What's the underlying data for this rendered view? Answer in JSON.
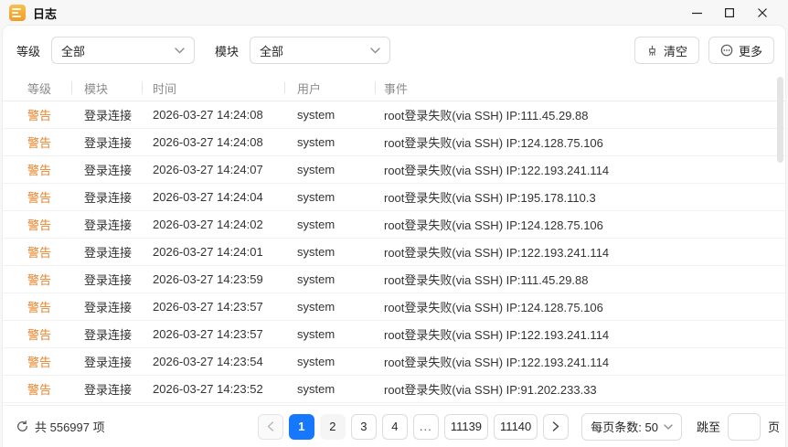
{
  "window": {
    "title": "日志"
  },
  "filters": {
    "level_label": "等级",
    "level_value": "全部",
    "module_label": "模块",
    "module_value": "全部"
  },
  "toolbar": {
    "clear_label": "清空",
    "more_label": "更多"
  },
  "table": {
    "headers": {
      "level": "等级",
      "module": "模块",
      "time": "时间",
      "user": "用户",
      "event": "事件"
    },
    "rows": [
      {
        "level": "警告",
        "module": "登录连接",
        "time": "2026-03-27 14:24:08",
        "user": "system",
        "event": "root登录失败(via SSH) IP:111.45.29.88"
      },
      {
        "level": "警告",
        "module": "登录连接",
        "time": "2026-03-27 14:24:08",
        "user": "system",
        "event": "root登录失败(via SSH) IP:124.128.75.106"
      },
      {
        "level": "警告",
        "module": "登录连接",
        "time": "2026-03-27 14:24:07",
        "user": "system",
        "event": "root登录失败(via SSH) IP:122.193.241.114"
      },
      {
        "level": "警告",
        "module": "登录连接",
        "time": "2026-03-27 14:24:04",
        "user": "system",
        "event": "root登录失败(via SSH) IP:195.178.110.3"
      },
      {
        "level": "警告",
        "module": "登录连接",
        "time": "2026-03-27 14:24:02",
        "user": "system",
        "event": "root登录失败(via SSH) IP:124.128.75.106"
      },
      {
        "level": "警告",
        "module": "登录连接",
        "time": "2026-03-27 14:24:01",
        "user": "system",
        "event": "root登录失败(via SSH) IP:122.193.241.114"
      },
      {
        "level": "警告",
        "module": "登录连接",
        "time": "2026-03-27 14:23:59",
        "user": "system",
        "event": "root登录失败(via SSH) IP:111.45.29.88"
      },
      {
        "level": "警告",
        "module": "登录连接",
        "time": "2026-03-27 14:23:57",
        "user": "system",
        "event": "root登录失败(via SSH) IP:124.128.75.106"
      },
      {
        "level": "警告",
        "module": "登录连接",
        "time": "2026-03-27 14:23:57",
        "user": "system",
        "event": "root登录失败(via SSH) IP:122.193.241.114"
      },
      {
        "level": "警告",
        "module": "登录连接",
        "time": "2026-03-27 14:23:54",
        "user": "system",
        "event": "root登录失败(via SSH) IP:122.193.241.114"
      },
      {
        "level": "警告",
        "module": "登录连接",
        "time": "2026-03-27 14:23:52",
        "user": "system",
        "event": "root登录失败(via SSH) IP:91.202.233.33"
      }
    ]
  },
  "footer": {
    "total_text": "共 556997 项",
    "pages": [
      "1",
      "2",
      "3",
      "4",
      "...",
      "11139",
      "11140"
    ],
    "active_page": "1",
    "page_size_label": "每页条数: 50",
    "jump_prefix": "跳至",
    "jump_suffix": "页",
    "jump_value": ""
  },
  "colors": {
    "warning_orange": "#e8832a",
    "accent_blue": "#1677ff",
    "app_icon_orange": "#f59a23"
  }
}
